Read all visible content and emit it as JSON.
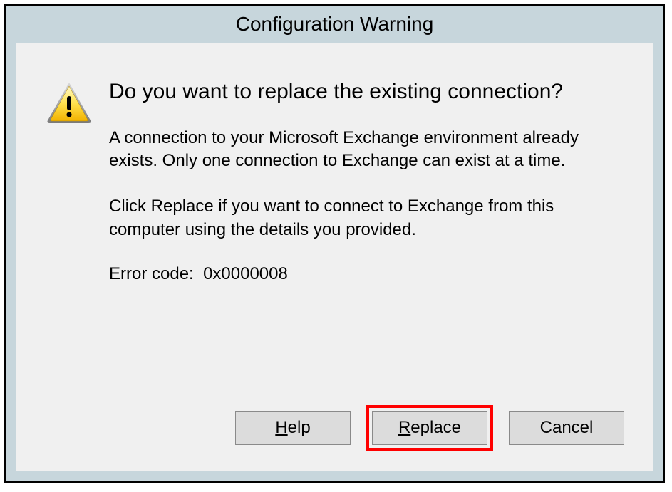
{
  "title": "Configuration Warning",
  "heading": "Do you want to replace the existing connection?",
  "body1": "A connection to your Microsoft Exchange environment already exists. Only one connection to Exchange can exist at a time.",
  "body2": "Click Replace if you want to connect to Exchange from this computer using the details you provided.",
  "error_label": "Error code:",
  "error_code": "0x0000008",
  "buttons": {
    "help_prefix": "H",
    "help_rest": "elp",
    "replace_prefix": "R",
    "replace_rest": "eplace",
    "cancel": "Cancel"
  }
}
